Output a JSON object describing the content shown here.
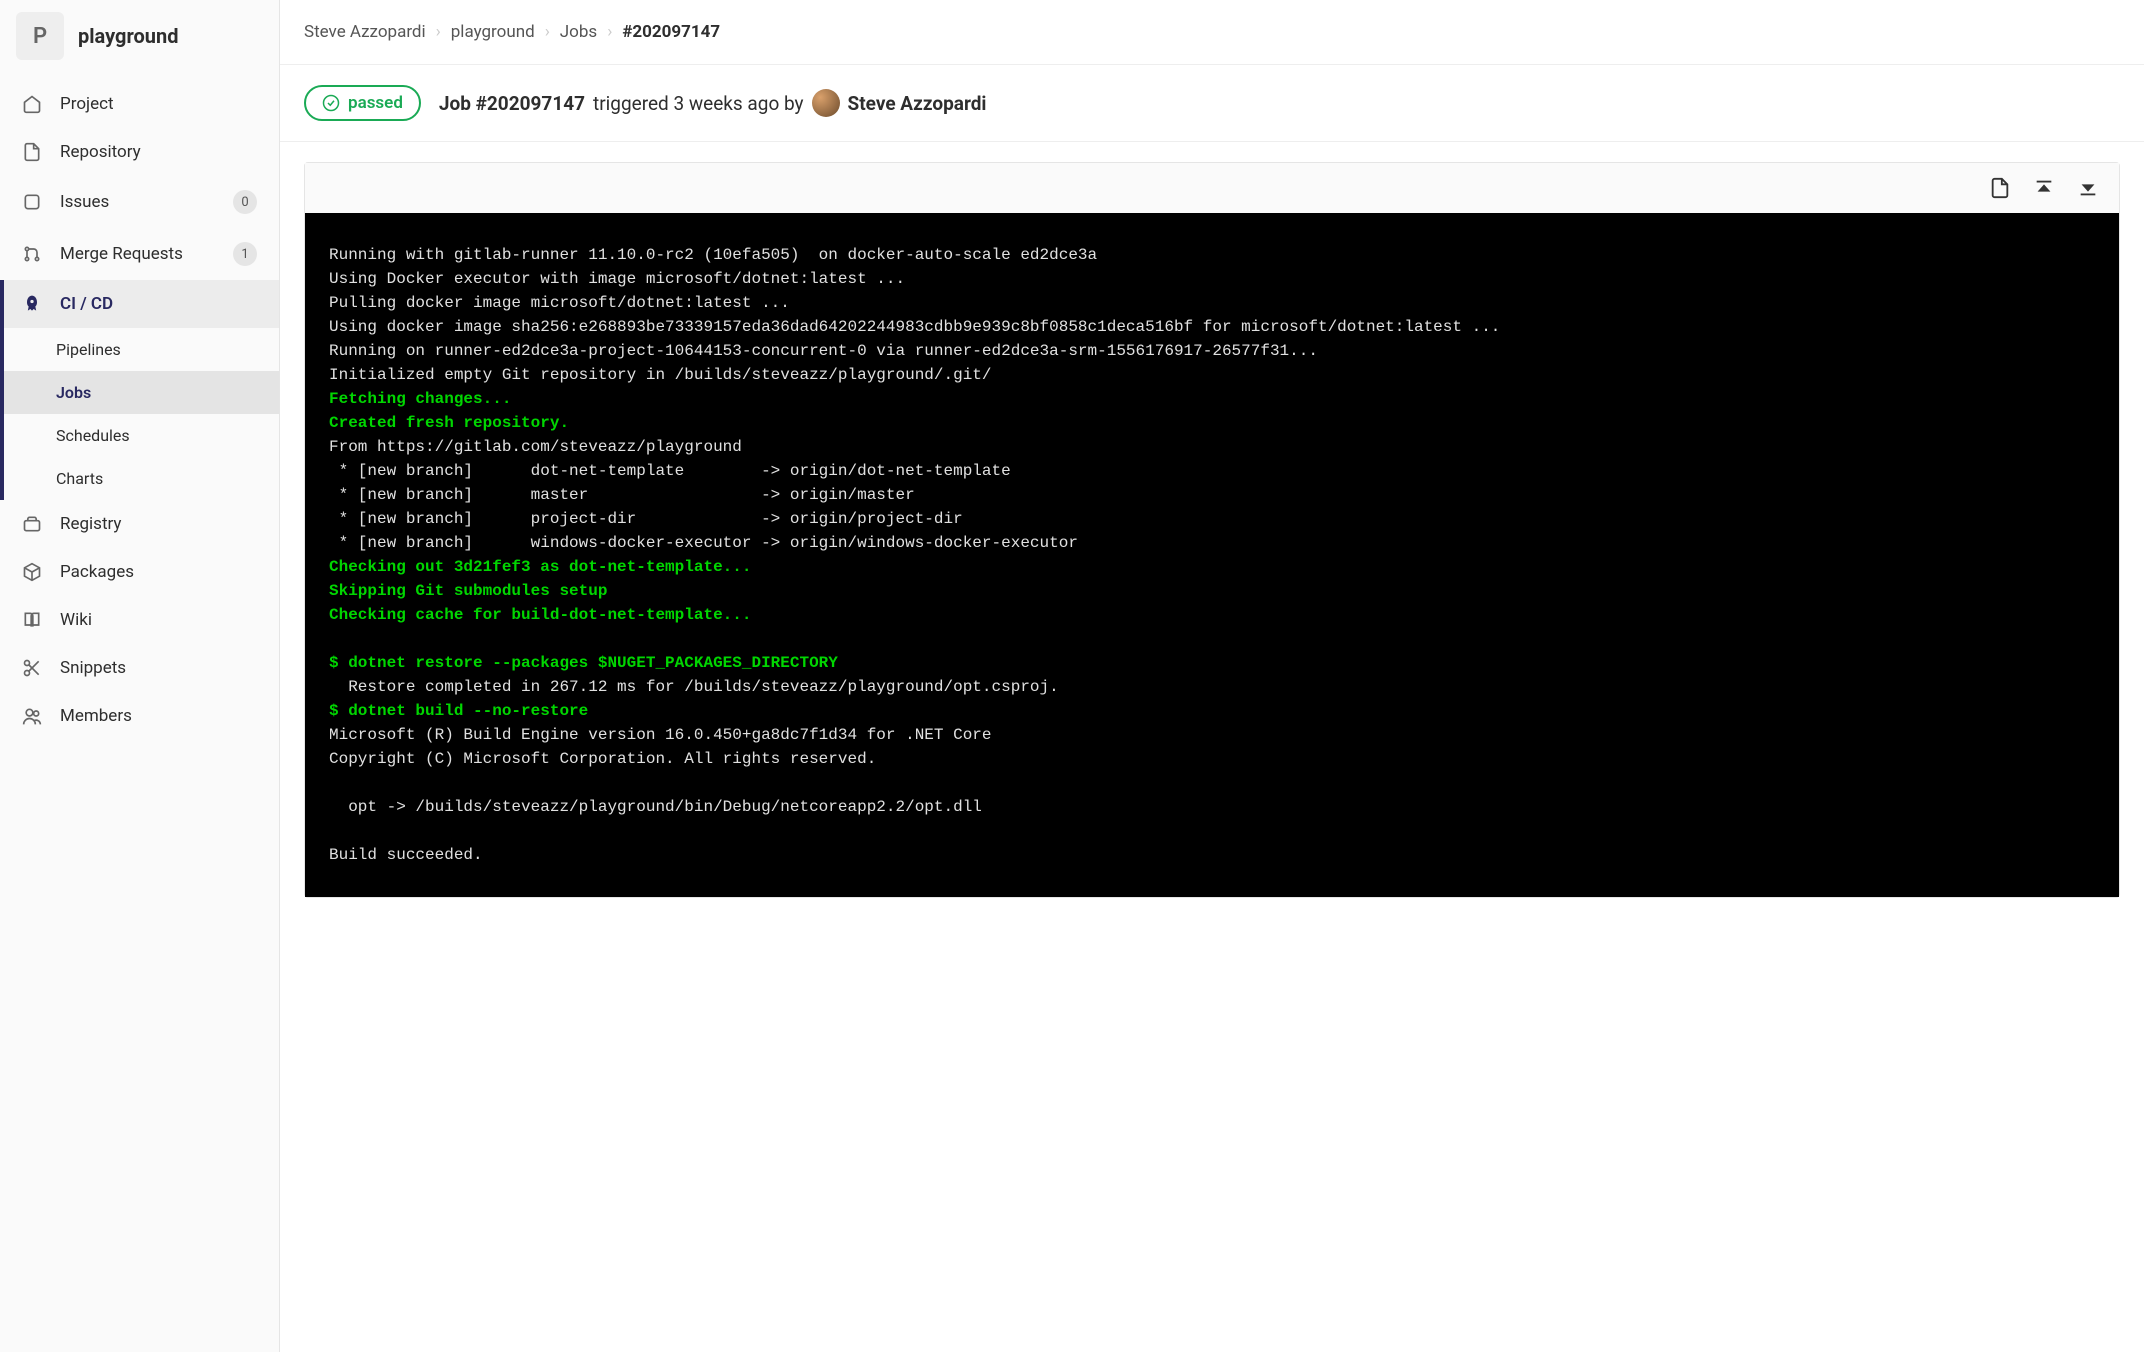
{
  "project": {
    "avatar_letter": "P",
    "name": "playground"
  },
  "sidebar": {
    "items": [
      {
        "label": "Project",
        "badge": null
      },
      {
        "label": "Repository",
        "badge": null
      },
      {
        "label": "Issues",
        "badge": "0"
      },
      {
        "label": "Merge Requests",
        "badge": "1"
      },
      {
        "label": "CI / CD",
        "badge": null
      },
      {
        "label": "Registry",
        "badge": null
      },
      {
        "label": "Packages",
        "badge": null
      },
      {
        "label": "Wiki",
        "badge": null
      },
      {
        "label": "Snippets",
        "badge": null
      },
      {
        "label": "Members",
        "badge": null
      }
    ],
    "cicd_sub": [
      "Pipelines",
      "Jobs",
      "Schedules",
      "Charts"
    ]
  },
  "breadcrumbs": {
    "0": "Steve Azzopardi",
    "1": "playground",
    "2": "Jobs",
    "3": "#202097147"
  },
  "job": {
    "status": "passed",
    "title_prefix": "Job #202097147",
    "triggered_text": "triggered 3 weeks ago by",
    "author": "Steve Azzopardi"
  },
  "console": {
    "l1": "Running with gitlab-runner 11.10.0-rc2 (10efa505)  on docker-auto-scale ed2dce3a",
    "l2": "Using Docker executor with image microsoft/dotnet:latest ...",
    "l3": "Pulling docker image microsoft/dotnet:latest ...",
    "l4": "Using docker image sha256:e268893be73339157eda36dad64202244983cdbb9e939c8bf0858c1deca516bf for microsoft/dotnet:latest ...",
    "l5": "Running on runner-ed2dce3a-project-10644153-concurrent-0 via runner-ed2dce3a-srm-1556176917-26577f31...",
    "l6": "Initialized empty Git repository in /builds/steveazz/playground/.git/",
    "l7": "Fetching changes...",
    "l8": "Created fresh repository.",
    "l9": "From https://gitlab.com/steveazz/playground",
    "l10": " * [new branch]      dot-net-template        -> origin/dot-net-template",
    "l11": " * [new branch]      master                  -> origin/master",
    "l12": " * [new branch]      project-dir             -> origin/project-dir",
    "l13": " * [new branch]      windows-docker-executor -> origin/windows-docker-executor",
    "l14": "Checking out 3d21fef3 as dot-net-template...",
    "l15": "Skipping Git submodules setup",
    "l16": "Checking cache for build-dot-net-template...",
    "l17": "",
    "l18": "$ dotnet restore --packages $NUGET_PACKAGES_DIRECTORY",
    "l19": "  Restore completed in 267.12 ms for /builds/steveazz/playground/opt.csproj.",
    "l20": "$ dotnet build --no-restore",
    "l21": "Microsoft (R) Build Engine version 16.0.450+ga8dc7f1d34 for .NET Core",
    "l22": "Copyright (C) Microsoft Corporation. All rights reserved.",
    "l23": "",
    "l24": "  opt -> /builds/steveazz/playground/bin/Debug/netcoreapp2.2/opt.dll",
    "l25": "",
    "l26": "Build succeeded."
  }
}
